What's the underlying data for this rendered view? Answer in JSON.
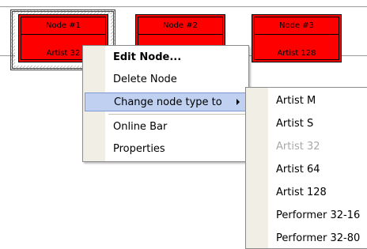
{
  "nodes": [
    {
      "title": "Node #1",
      "type": "Artist 32"
    },
    {
      "title": "Node #2",
      "type": ""
    },
    {
      "title": "Node #3",
      "type": "Artist 128"
    }
  ],
  "context_menu": {
    "items": [
      {
        "label": "Edit Node...",
        "bold": true
      },
      {
        "label": "Delete Node"
      },
      {
        "label": "Change node type to",
        "submenu": true
      },
      {
        "label": "Online Bar"
      },
      {
        "label": "Properties"
      }
    ]
  },
  "submenu": {
    "items": [
      {
        "label": "Artist M",
        "disabled": false
      },
      {
        "label": "Artist S",
        "disabled": false
      },
      {
        "label": "Artist 32",
        "disabled": true
      },
      {
        "label": "Artist 64",
        "disabled": false
      },
      {
        "label": "Artist 128",
        "disabled": false
      },
      {
        "label": "Performer 32-16",
        "disabled": false
      },
      {
        "label": "Performer 32-80",
        "disabled": false
      }
    ]
  },
  "colors": {
    "node_fill": "#ff0000",
    "menu_highlight": "#c0d0f0",
    "menu_gutter": "#f1efe5"
  }
}
